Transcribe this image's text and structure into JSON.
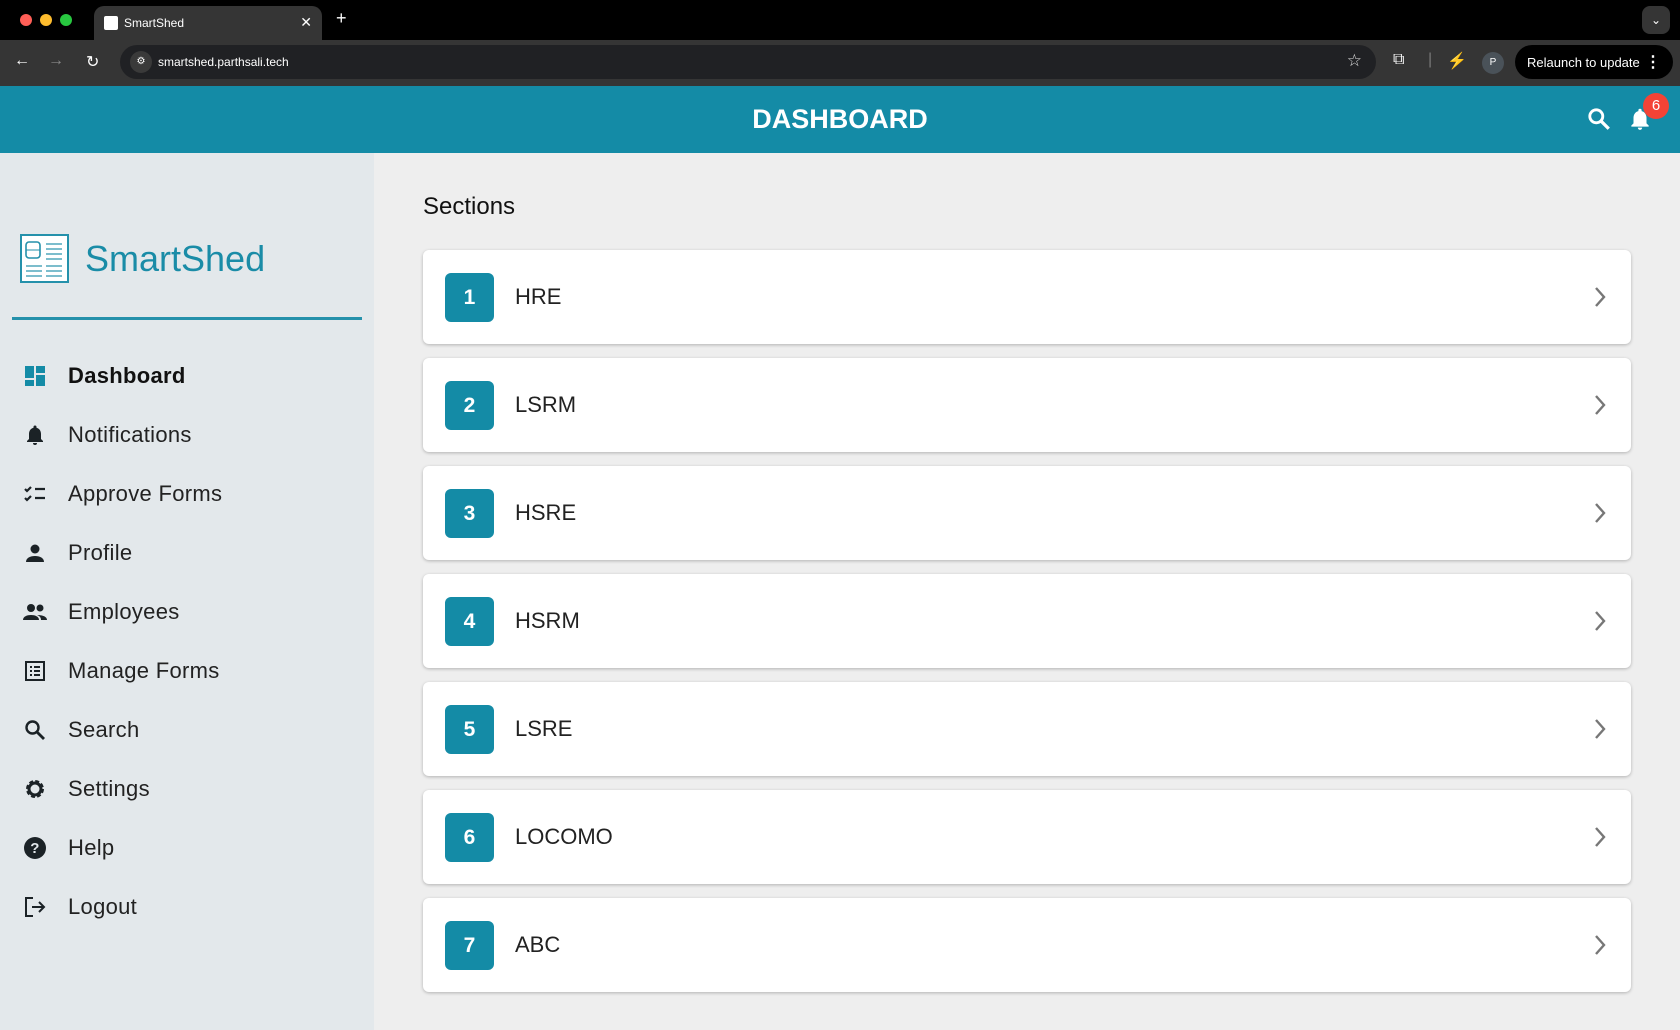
{
  "browser": {
    "tab_title": "SmartShed",
    "url": "smartshed.parthsali.tech",
    "relaunch_label": "Relaunch to update",
    "profile_initial": "P"
  },
  "header": {
    "title": "DASHBOARD",
    "notification_count": "6",
    "accent": "#148ba6"
  },
  "sidebar": {
    "brand": "SmartShed",
    "items": [
      {
        "label": "Dashboard",
        "icon": "dashboard-icon"
      },
      {
        "label": "Notifications",
        "icon": "bell-icon"
      },
      {
        "label": "Approve Forms",
        "icon": "checklist-icon"
      },
      {
        "label": "Profile",
        "icon": "person-icon"
      },
      {
        "label": "Employees",
        "icon": "people-icon"
      },
      {
        "label": "Manage Forms",
        "icon": "list-icon"
      },
      {
        "label": "Search",
        "icon": "search-icon"
      },
      {
        "label": "Settings",
        "icon": "gear-icon"
      },
      {
        "label": "Help",
        "icon": "help-icon"
      },
      {
        "label": "Logout",
        "icon": "logout-icon"
      }
    ]
  },
  "main": {
    "title": "Sections",
    "sections": [
      {
        "num": "1",
        "label": "HRE"
      },
      {
        "num": "2",
        "label": "LSRM"
      },
      {
        "num": "3",
        "label": "HSRE"
      },
      {
        "num": "4",
        "label": "HSRM"
      },
      {
        "num": "5",
        "label": "LSRE"
      },
      {
        "num": "6",
        "label": "LOCOMO"
      },
      {
        "num": "7",
        "label": "ABC"
      }
    ]
  }
}
